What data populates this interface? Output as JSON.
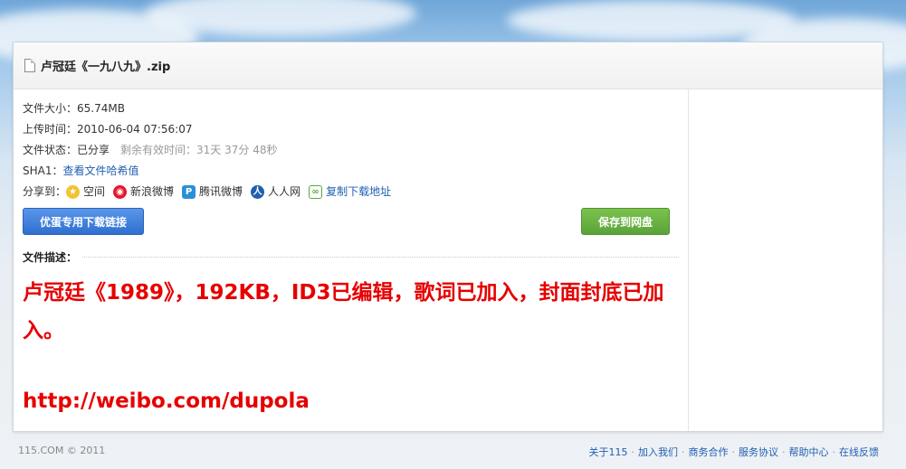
{
  "header": {
    "file_name": "卢冠廷《一九八九》.zip"
  },
  "info": {
    "size_label": "文件大小：",
    "size_value": "65.74MB",
    "upload_label": "上传时间：",
    "upload_value": "2010-06-04 07:56:07",
    "status_label": "文件状态：",
    "status_value": "已分享",
    "remaining": "剩余有效时间：31天 37分 48秒",
    "sha1_label": "SHA1：",
    "sha1_link": "查看文件哈希值",
    "share_label": "分享到：",
    "share_items": [
      {
        "label": "空间",
        "icon": "qzone-icon"
      },
      {
        "label": "新浪微博",
        "icon": "sina-weibo-icon"
      },
      {
        "label": "腾讯微博",
        "icon": "tencent-weibo-icon"
      },
      {
        "label": "人人网",
        "icon": "renren-icon"
      },
      {
        "label": "复制下载地址",
        "icon": "copy-link-icon"
      }
    ]
  },
  "buttons": {
    "download": "优蛋专用下载链接",
    "save": "保存到网盘"
  },
  "description": {
    "label": "文件描述：",
    "text": "卢冠廷《1989》，192KB，ID3已编辑，歌词已加入，封面封底已加入。",
    "url": "http://weibo.com/dupola"
  },
  "footer": {
    "copyright": "115.COM © 2011",
    "links": [
      "关于115",
      "加入我们",
      "商务合作",
      "服务协议",
      "帮助中心",
      "在线反馈"
    ]
  },
  "colors": {
    "accent_link": "#1f5fb0",
    "description_red": "#e60000",
    "download_blue": "#3a7ddb",
    "save_green": "#66b042"
  }
}
